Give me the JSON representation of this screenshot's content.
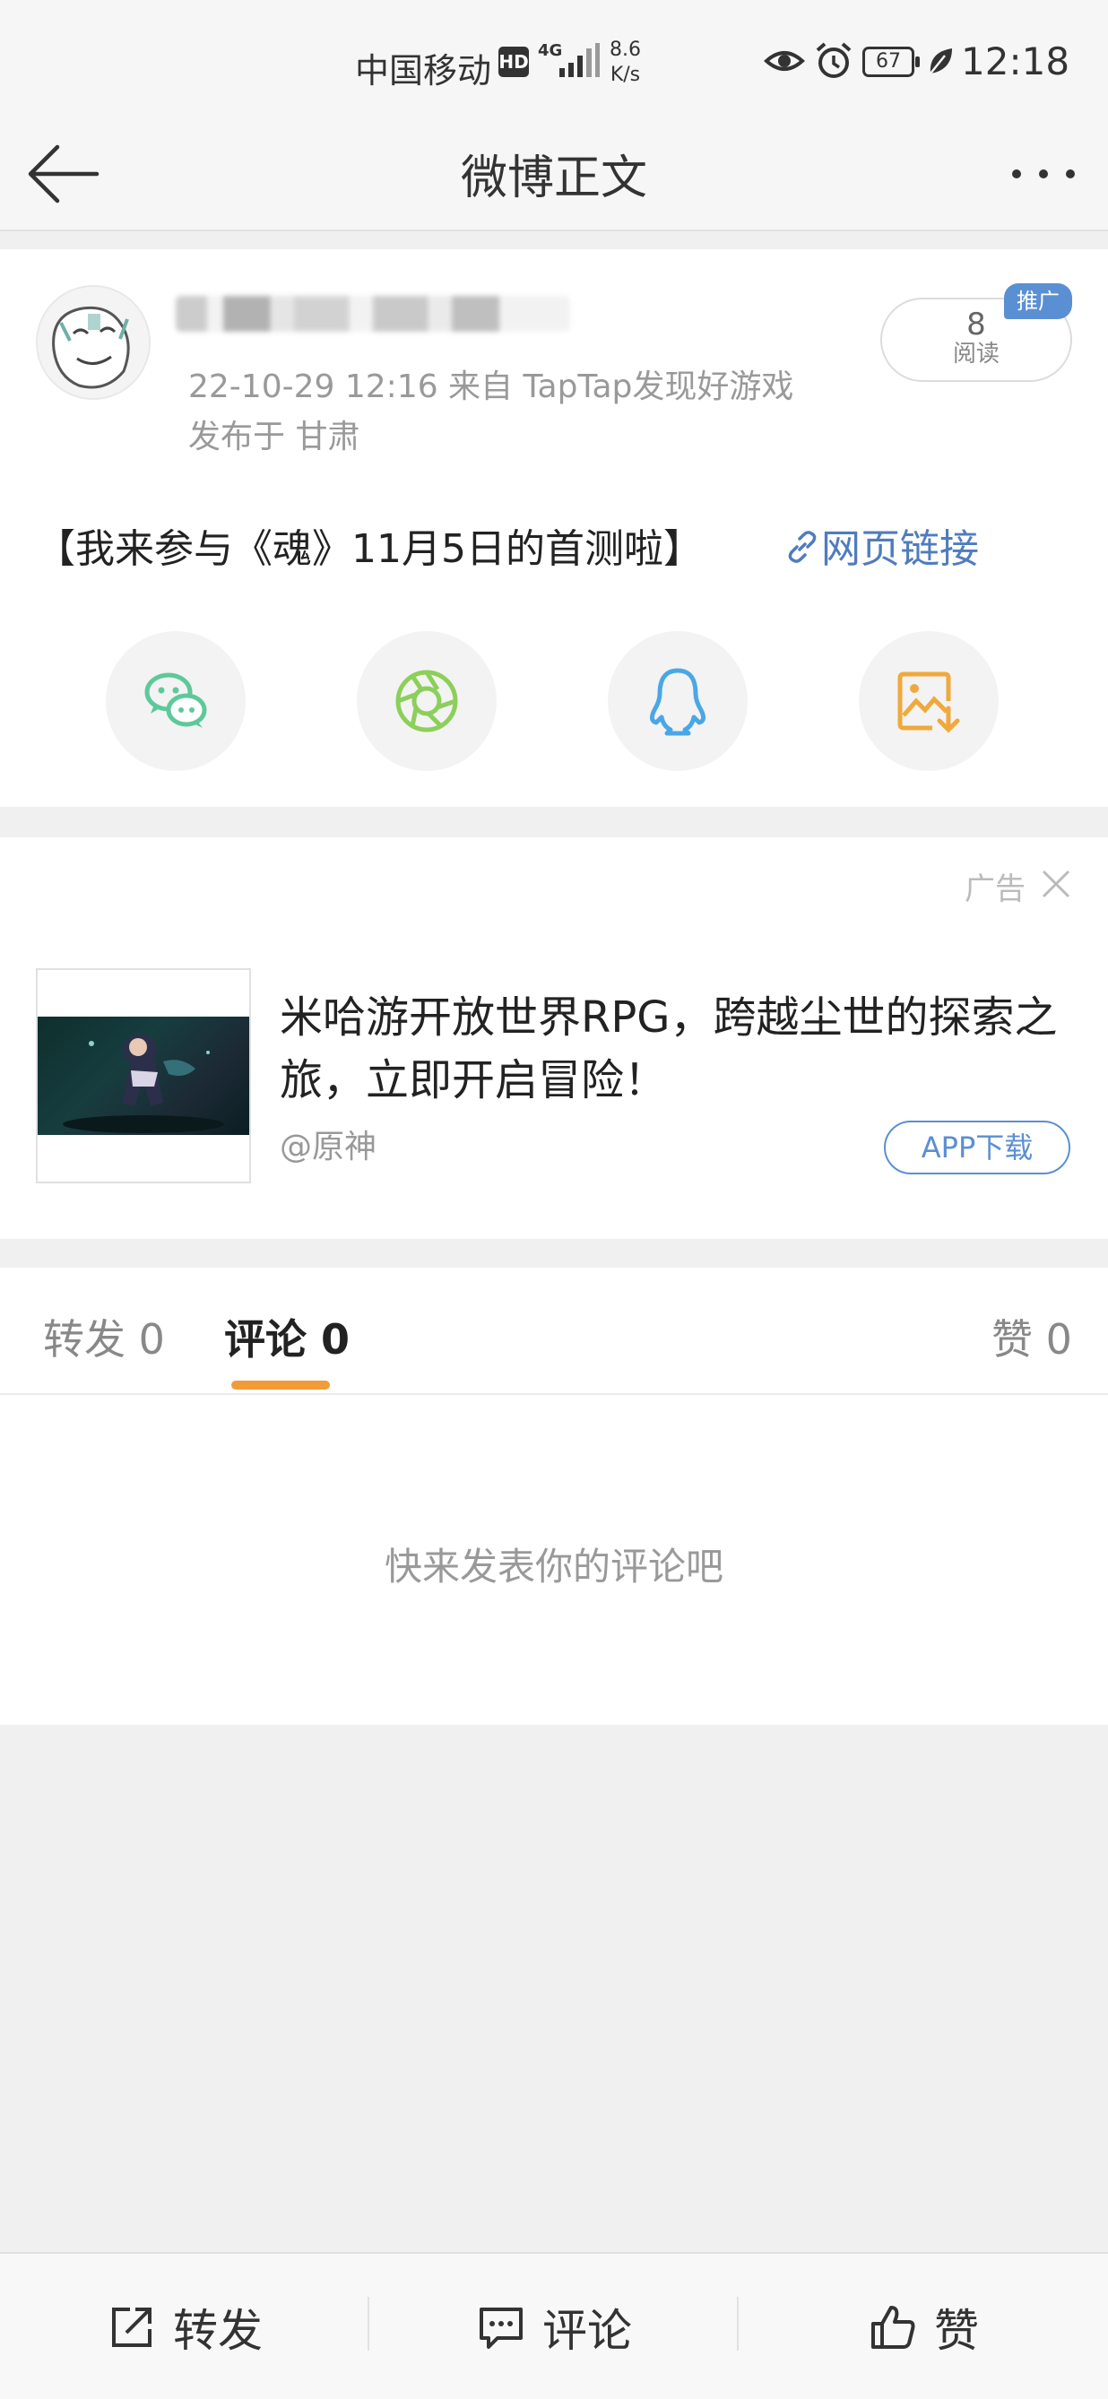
{
  "status_bar": {
    "carrier": "中国移动",
    "hd": "HD",
    "network": "4G",
    "speed_value": "8.6",
    "speed_unit": "K/s",
    "battery": "67",
    "time": "12:18"
  },
  "nav": {
    "title": "微博正文"
  },
  "post": {
    "meta_time_source": "22-10-29 12:16  来自 TapTap发现好游戏",
    "meta_location": "发布于 甘肃",
    "read_count": "8",
    "read_label": "阅读",
    "promo_tag": "推广",
    "text": "【我来参与《魂》11月5日的首测啦】",
    "link_text": "网页链接",
    "share_targets": [
      "wechat-icon",
      "moments-icon",
      "qq-icon",
      "save-image-icon"
    ]
  },
  "ad": {
    "label": "广告",
    "title": "米哈游开放世界RPG，跨越尘世的探索之旅，立即开启冒险！",
    "source": "@原神",
    "button": "APP下载"
  },
  "tabs": {
    "repost": "转发 0",
    "comment": "评论 0",
    "like": "赞 0"
  },
  "comments": {
    "empty_text": "快来发表你的评论吧"
  },
  "bottom_bar": {
    "repost": "转发",
    "comment": "评论",
    "like": "赞"
  },
  "colors": {
    "accent_orange": "#f29b38",
    "link_blue": "#4f7cbe",
    "wechat_green": "#5dc99a",
    "moments_green": "#8ccf5a",
    "qq_blue": "#4aa7e6",
    "save_orange": "#f0a93c"
  }
}
